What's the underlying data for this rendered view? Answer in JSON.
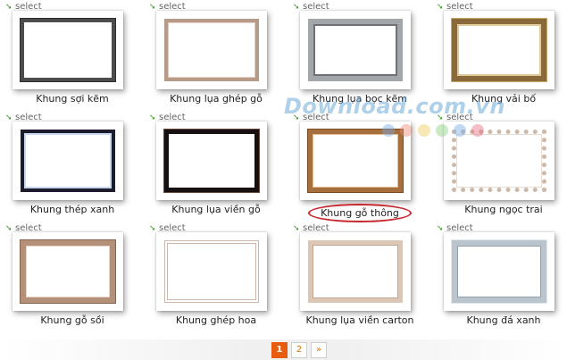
{
  "select_label": "select",
  "items": [
    {
      "name": "Khung sợi kẽm"
    },
    {
      "name": "Khung lụa ghép gỗ"
    },
    {
      "name": "Khung lụa bọc kẽm"
    },
    {
      "name": "Khung vải bố"
    },
    {
      "name": "Khung thép xanh"
    },
    {
      "name": "Khung lụa viền gỗ"
    },
    {
      "name": "Khung gỗ thông"
    },
    {
      "name": "Khung ngọc trai"
    },
    {
      "name": "Khung gỗ sồi"
    },
    {
      "name": "Khung ghép hoa"
    },
    {
      "name": "Khung lụa viền carton"
    },
    {
      "name": "Khung đá xanh"
    }
  ],
  "highlighted_item": "Khung gỗ thông",
  "watermark": {
    "text": "Download.com.vn"
  },
  "pagination": {
    "pages": [
      "1",
      "2"
    ],
    "current": "1",
    "next": "»"
  },
  "colors": {
    "accent": "#e85c0f",
    "highlight_circle": "#c8262b",
    "select_arrow": "#3a9a1f"
  }
}
